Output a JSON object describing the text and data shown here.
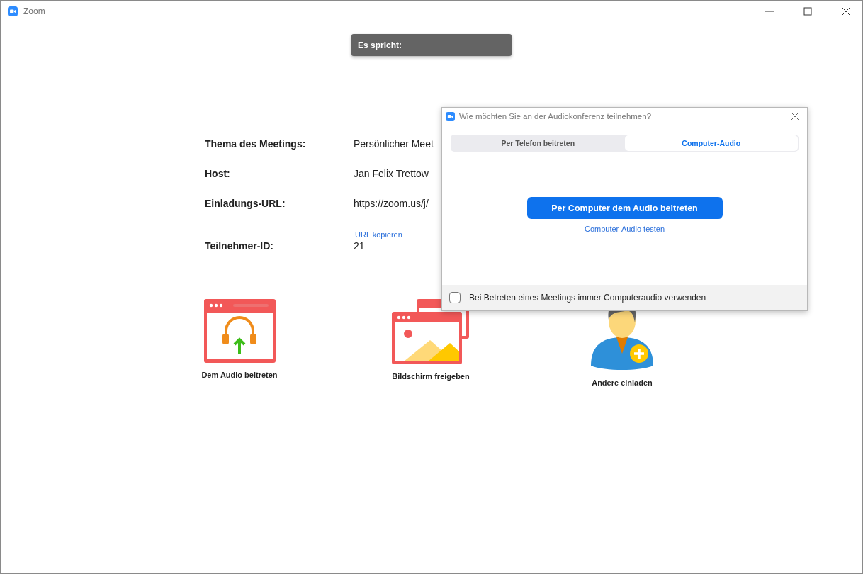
{
  "window": {
    "title": "Zoom"
  },
  "speaker_banner": {
    "label": "Es spricht:"
  },
  "meeting_info": [
    {
      "label": "Thema des Meetings:",
      "value": "Persönlicher Meet"
    },
    {
      "label": "Host:",
      "value": "Jan Felix Trettow"
    },
    {
      "label": "Einladungs-URL:",
      "value": "https://zoom.us/j/",
      "link": "URL kopieren"
    },
    {
      "label": "Teilnehmer-ID:",
      "value": "21"
    }
  ],
  "actions": [
    {
      "kind": "audio",
      "label": "Dem Audio beitreten"
    },
    {
      "kind": "share",
      "label": "Bildschirm freigeben"
    },
    {
      "kind": "invite",
      "label": "Andere einladen"
    }
  ],
  "dialog": {
    "title": "Wie möchten Sie an der Audiokonferenz teilnehmen?",
    "tabs": [
      {
        "label": "Per Telefon beitreten",
        "selected": false
      },
      {
        "label": "Computer-Audio",
        "selected": true
      }
    ],
    "primary_button": "Per Computer dem Audio beitreten",
    "test_link": "Computer-Audio testen",
    "checkbox": {
      "label": "Bei Betreten eines Meetings immer Computeraudio verwenden",
      "checked": false
    }
  }
}
